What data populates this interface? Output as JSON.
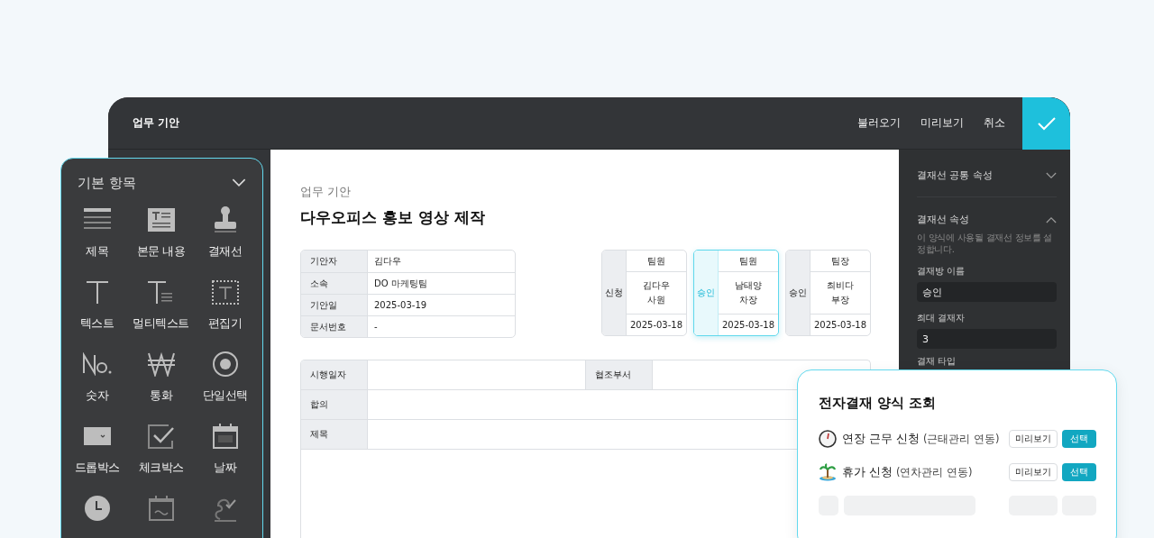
{
  "window": {
    "title": "업무 기안",
    "actions": [
      {
        "label": "불러오기"
      },
      {
        "label": "미리보기"
      },
      {
        "label": "취소"
      }
    ]
  },
  "palette": {
    "title": "기본 항목",
    "items": [
      {
        "kind": "labeled",
        "label": "제목"
      },
      {
        "kind": "labeled",
        "label": "본문 내용"
      },
      {
        "kind": "labeled",
        "label": "결재선"
      },
      {
        "kind": "labeled",
        "label": "텍스트"
      },
      {
        "kind": "labeled",
        "label": "멀티텍스트"
      },
      {
        "kind": "labeled",
        "label": "편집기"
      },
      {
        "kind": "labeled",
        "label": "숫자"
      },
      {
        "kind": "labeled",
        "label": "통화"
      },
      {
        "kind": "labeled",
        "label": "단일선택"
      },
      {
        "kind": "labeled",
        "label": "드롭박스"
      },
      {
        "kind": "labeled",
        "label": "체크박스"
      },
      {
        "kind": "labeled",
        "label": "날짜"
      },
      {
        "kind": "icon_only"
      },
      {
        "kind": "icon_only"
      },
      {
        "kind": "icon_only"
      }
    ]
  },
  "document": {
    "category": "업무 기안",
    "title": "다우오피스 홍보 영상 제작",
    "info": [
      {
        "label": "기안자",
        "value": "김다우"
      },
      {
        "label": "소속",
        "value": "DO 마케팅팀"
      },
      {
        "label": "기안일",
        "value": "2025-03-19"
      },
      {
        "label": "문서번호",
        "value": "-"
      }
    ],
    "approvals": [
      {
        "type": "신청",
        "position": "팀원",
        "name": "김다우",
        "rank": "사원",
        "date": "2025-03-18",
        "selected": false
      },
      {
        "type": "승인",
        "position": "팀원",
        "name": "남태양",
        "rank": "차장",
        "date": "2025-03-18",
        "selected": true
      },
      {
        "type": "승인",
        "position": "팀장",
        "name": "최비다",
        "rank": "부장",
        "date": "2025-03-18",
        "selected": false
      }
    ],
    "fields": [
      {
        "cells": [
          {
            "label": "시행일자"
          },
          {
            "label": "협조부서"
          }
        ]
      },
      {
        "cells": [
          {
            "label": "합의"
          }
        ]
      },
      {
        "cells": [
          {
            "label": "제목"
          }
        ]
      }
    ]
  },
  "properties": {
    "sections": [
      {
        "title": "결재선 공통 속성",
        "expanded": false
      },
      {
        "title": "결재선 속성",
        "expanded": true,
        "description": "이 양식에 사용될 결재선 정보를 설정합니다.",
        "fields": [
          {
            "label": "결재방 이름",
            "value": "승인"
          },
          {
            "label": "최대 결재자",
            "value": "3"
          },
          {
            "label": "결재 타입"
          }
        ]
      }
    ]
  },
  "dialog": {
    "title": "전자결재 양식 조회",
    "forms": [
      {
        "name": "연장 근무 신청",
        "note": "(근태관리 연동)",
        "preview": "미리보기",
        "select": "선택"
      },
      {
        "name": "휴가 신청",
        "note": "(연차관리 연동)",
        "preview": "미리보기",
        "select": "선택"
      }
    ]
  }
}
